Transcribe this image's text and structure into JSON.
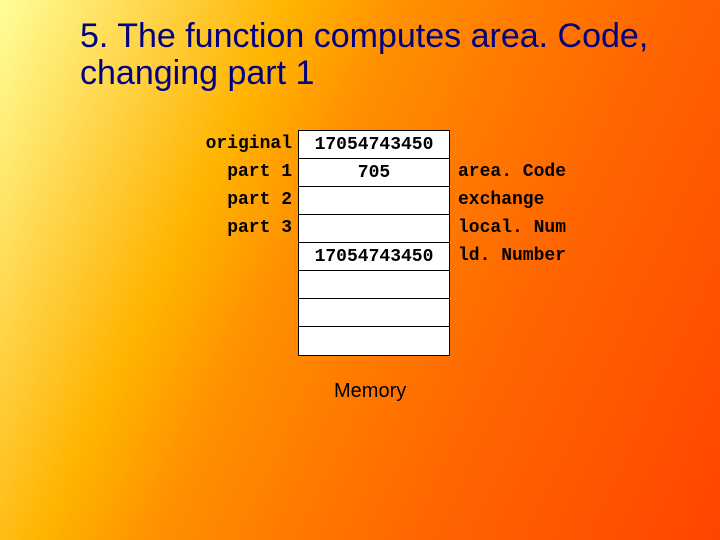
{
  "title": "5. The function computes area. Code, changing part 1",
  "left_labels": {
    "r0": "original",
    "r1": "part 1",
    "r2": "part 2",
    "r3": "part 3"
  },
  "memory_cells": {
    "c0": "17054743450",
    "c1": "705",
    "c2": "",
    "c3": "",
    "c4": "17054743450",
    "c5": "",
    "c6": "",
    "c7": ""
  },
  "right_labels": {
    "r1": "area. Code",
    "r2": "exchange",
    "r3": "local. Num",
    "r4": "ld. Number"
  },
  "memory_caption": "Memory"
}
